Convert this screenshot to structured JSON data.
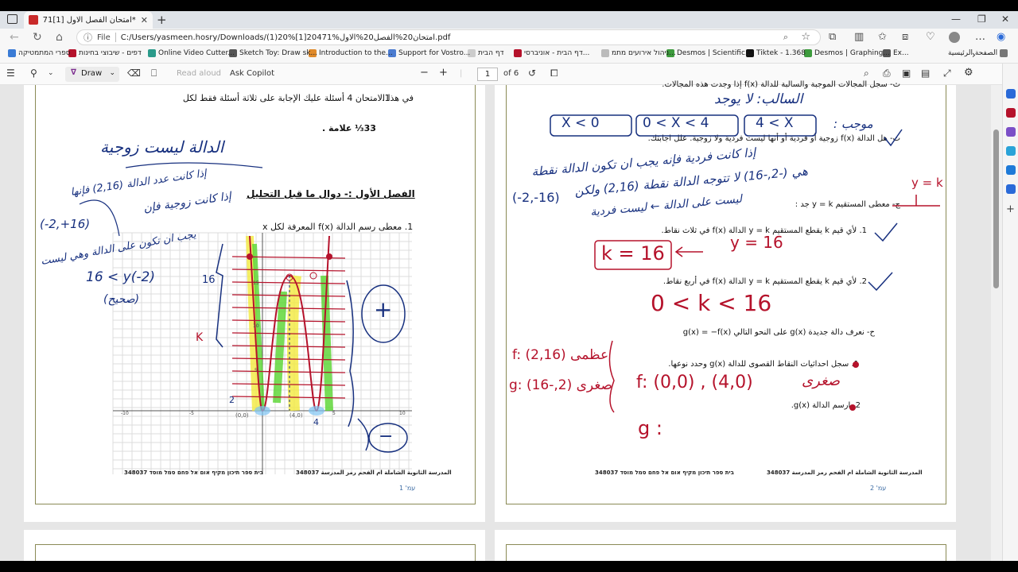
{
  "tab": {
    "title": "*امتحان الفصل الاول [1]471 (1).pdf"
  },
  "address": {
    "label": "File",
    "url": "C:/Users/yasmeen.hosry/Downloads/(1)20%[1]20471%امتحان20%الفصل20%الاول.pdf"
  },
  "favorites": [
    "ספרי המתמטיקה",
    "דפים - שיבוצי בחינות",
    "Online Video Cutter...",
    "Sketch Toy: Draw sk...",
    "Introduction to the...",
    "Support for Vostro...",
    "דף הבית",
    "דף הבית - אוניברסי...",
    "ניהול אירועים מתמ...",
    "Desmos | Scientific...",
    "Tiktek - 1.368",
    "Desmos | Graphing...",
    "Ex...",
    "الصفحة الرئيسية"
  ],
  "toolbar": {
    "draw": "Draw",
    "read_aloud": "Read aloud",
    "ask_copilot": "Ask Copilot",
    "page": "1",
    "of_pages": "of 6"
  },
  "page1": {
    "instruction_num": "1.",
    "instruction": "في هذا الامتحان 4 أسئلة  عليك الإجابة على ثلاثة أسئلة فقط لكل",
    "marks": "33⅓ علامة .",
    "section_title": "الفصل الأول :- دوال ما قبل التحليل",
    "q1": "1. معطى رسم الدالة f(x) المعرفة لكل x",
    "footer_left": "348037 בית ספר תיכון מקיף אום אל פחם סמל מוסד",
    "footer_right": "المدرسة الثانوية الشاملة ام الفحم رمز المدرسة 348037",
    "page_label": "עמ' 1"
  },
  "page2": {
    "line0": "ث- سجل المجالات الموجبة والسالبة للدالة f(x) إذا وجدت هذه المجالات.",
    "line_th": "ث- هل الدالة f(x) زوجية أو فردية أو أنها ليست فردية ولا زوجية. علل اجابتك.",
    "line_j": "ج- معطى المستقيم y = k جد :",
    "j1": "1. لأي قيم k يقطع المستقيم y = k الدالة f(x) في ثلاث نقاط.",
    "j2": "2. لأي قيم k يقطع المستقيم y = k الدالة f(x) في أربع نقاط.",
    "line_h": "ح- نعرف دالة جديدة g(x) على النحو التالي g(x) = −f(x)",
    "h1": "1. سجل احداثيات النقاط القصوى للدالة g(x) وحدد نوعها.",
    "h2": "2. ارسم الدالة g(x).",
    "footer_left": "348037 בית ספר תיכון מקיף אום אל פחם סמל מוסד",
    "footer_right": "المدرسة الثانوية الشاملة ام الفحم رمز المدرسة 348037",
    "page_label": "עמ' 2"
  },
  "graph": {
    "x_labels": [
      "-10",
      "-5",
      "5",
      "10"
    ],
    "y_labels": [
      "15",
      "10",
      "5"
    ]
  },
  "handwriting": {
    "p1_a": "الدالة ليست زوجية",
    "p1_b": "إذا كانت عدد الدالة (2,16) فإنها",
    "p1_c": "إذا كانت زوجية فإن",
    "p1_d": "(-2,+16)",
    "p1_e": "يجب ان تكون على الدالة وهي ليست",
    "p1_f": "16 < y(-2)",
    "p1_g": "(صحيح)",
    "p1_16": "16",
    "p1_k": "K",
    "p1_2": "2",
    "p1_4": "4",
    "p1_plus": "+",
    "p1_minus": "−",
    "p1_pt1": "(0,0)",
    "p1_pt2": "(4,0)",
    "p2_a": "السالب: لا يوجد",
    "p2_b": "موجب :",
    "p2_int1": "X < 0",
    "p2_int2": "0 < X < 4",
    "p2_int3": "4 < X",
    "p2_c": "إذا كانت فردية فإنه يجب ان تكون الدالة نقطة",
    "p2_d": "هي (-2,-16) لا تتوجه الدالة نقطة (2,16) ولكن",
    "p2_e": "(-2,-16)",
    "p2_f": "ليست على الدالة ← ليست فردية",
    "p2_yk": "y = k",
    "p2_k16": "k = 16",
    "p2_y16": "y = 16",
    "p2_range": "0 < k < 16",
    "p2_f1": "f: عظمى (2,16)",
    "p2_g1": "g: صغرى (2,-16)",
    "p2_f2": "f: (0,0) , (4,0)",
    "p2_min": "صغرى",
    "p2_g2": "g :"
  },
  "colors": {
    "ink": "#17307f",
    "green": "#56d42e",
    "yellow": "#f2ea3d",
    "red": "#b5122b",
    "frame": "#8a8a55"
  }
}
